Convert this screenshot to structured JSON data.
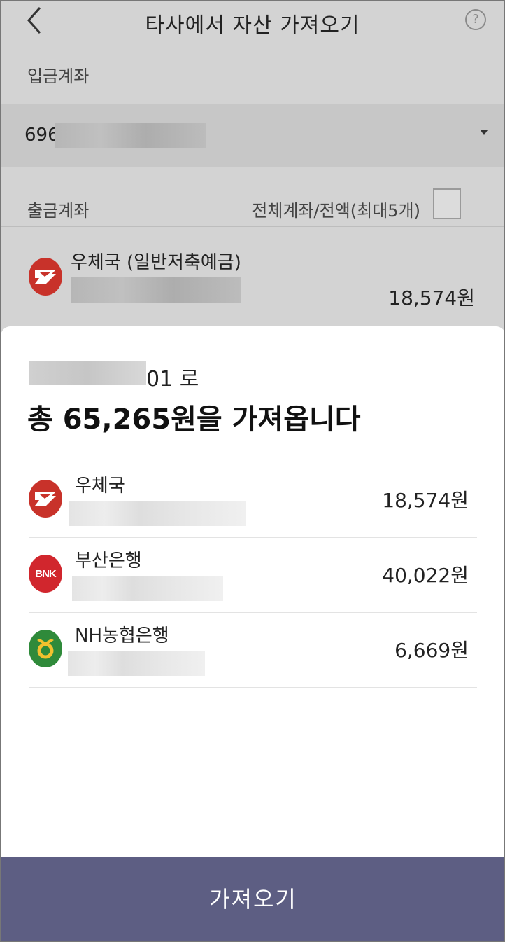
{
  "header": {
    "title": "타사에서 자산 가져오기",
    "help_icon": "?"
  },
  "deposit": {
    "label": "입금계좌",
    "account_prefix": "696"
  },
  "withdraw": {
    "label": "출금계좌",
    "all_accounts_label": "전체계좌/전액(최대5개)"
  },
  "background_bank": {
    "name": "우체국 (일반저축예금)",
    "amount": "18,574원"
  },
  "sheet": {
    "to_suffix": "01 로",
    "headline": "총 65,265원을 가져옵니다",
    "items": [
      {
        "name": "우체국",
        "amount": "18,574원",
        "logo": "post-office-logo"
      },
      {
        "name": "부산은행",
        "amount": "40,022원",
        "logo": "bnk-logo",
        "logo_text": "BNK"
      },
      {
        "name": "NH농협은행",
        "amount": "6,669원",
        "logo": "nh-logo"
      }
    ]
  },
  "cta": {
    "label": "가져오기"
  },
  "colors": {
    "cta_bg": "#5d5e83",
    "post_red": "#c8322a",
    "bnk_red": "#d1262d",
    "nh_green": "#2f8a3a"
  }
}
